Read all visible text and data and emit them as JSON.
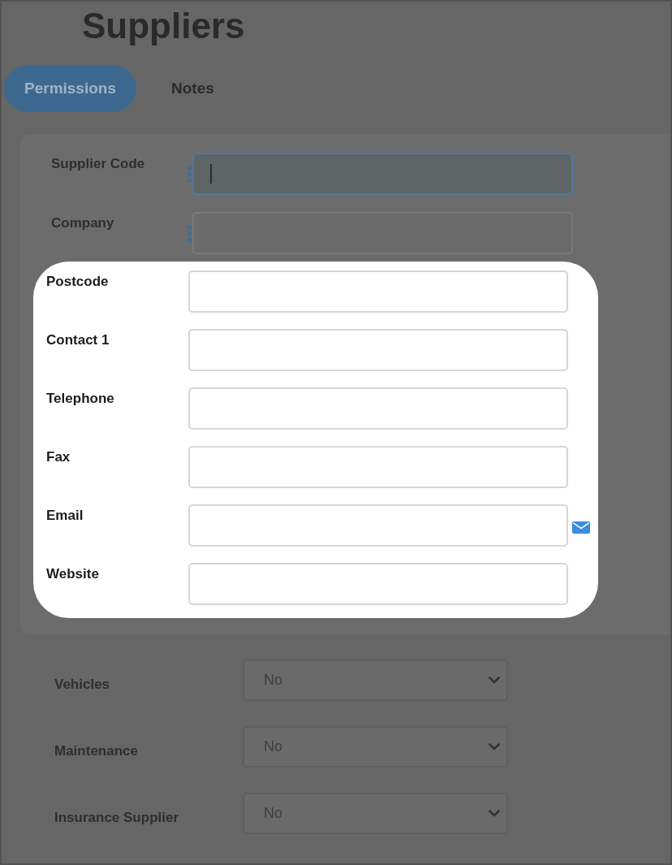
{
  "title": "Suppliers",
  "tabs": [
    {
      "label": "Permissions",
      "selected": true
    },
    {
      "label": "Notes",
      "selected": false
    }
  ],
  "form": {
    "fields": [
      {
        "label": "Supplier Code",
        "required": true,
        "focused": true
      },
      {
        "label": "Company",
        "required": true,
        "focused": false
      }
    ],
    "highlighted_fields": [
      {
        "label": "Postcode",
        "kind": "text"
      },
      {
        "label": "Contact 1",
        "kind": "text"
      },
      {
        "label": "Telephone",
        "kind": "text"
      },
      {
        "label": "Fax",
        "kind": "text"
      },
      {
        "label": "Email",
        "kind": "email"
      },
      {
        "label": "Website",
        "kind": "text"
      }
    ]
  },
  "permissions": [
    {
      "label": "Vehicles",
      "value": "No"
    },
    {
      "label": "Maintenance",
      "value": "No"
    },
    {
      "label": "Insurance Supplier",
      "value": "No"
    }
  ]
}
